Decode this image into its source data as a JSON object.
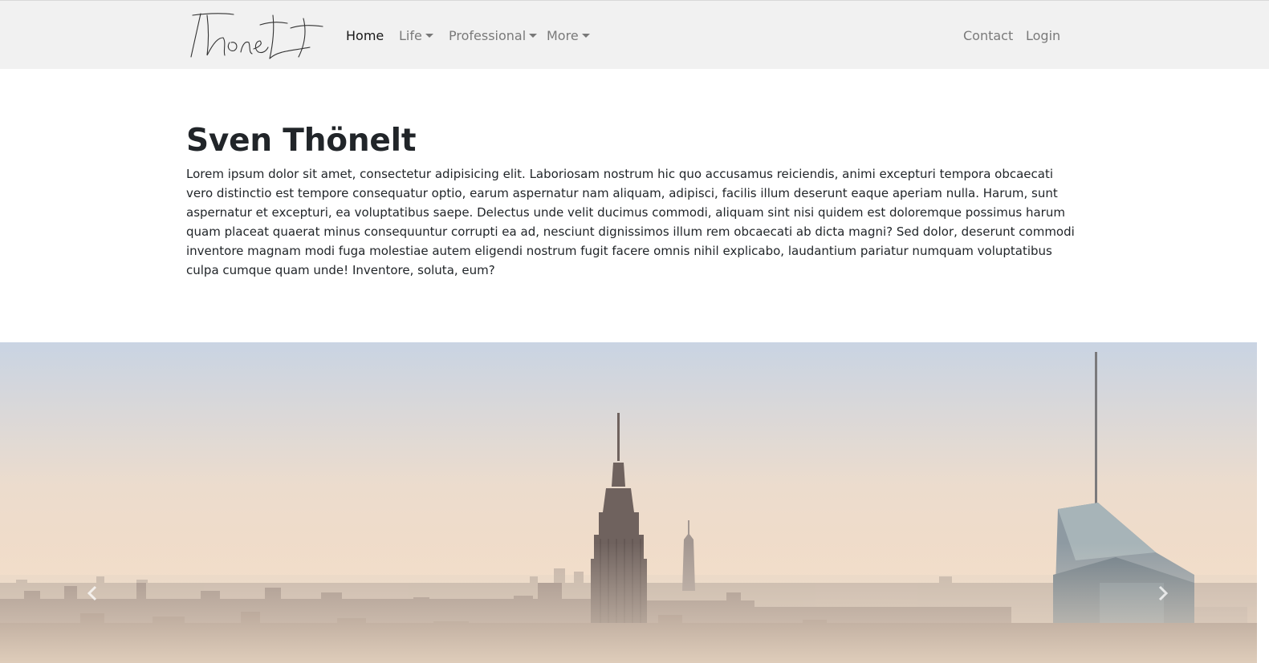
{
  "navbar": {
    "brand_logo": "Thönelt",
    "items": [
      {
        "label": "Home"
      },
      {
        "label": "Life"
      },
      {
        "label": "Professional"
      },
      {
        "label": "More"
      }
    ],
    "right_items": [
      {
        "label": "Contact"
      },
      {
        "label": "Login"
      }
    ]
  },
  "main": {
    "title": "Sven Thönelt",
    "intro": "Lorem ipsum dolor sit amet, consectetur adipisicing elit. Laboriosam nostrum hic quo accusamus reiciendis, animi excepturi tempora obcaecati vero distinctio est tempore consequatur optio, earum aspernatur nam aliquam, adipisci, facilis illum deserunt eaque aperiam nulla. Harum, sunt aspernatur et excepturi, ea voluptatibus saepe. Delectus unde velit ducimus commodi, aliquam sint nisi quidem est doloremque possimus harum quam placeat quaerat minus consequuntur corrupti ea ad, nesciunt dignissimos illum rem obcaecati ab dicta magni? Sed dolor, deserunt commodi inventore magnam modi fuga molestiae autem eligendi nostrum fugit facere omnis nihil explicabo, laudantium pariatur numquam voluptatibus culpa cumque quam unde! Inventore, soluta, eum?"
  },
  "carousel": {
    "slide_image": "city-skyline-photo",
    "prev_icon": "chevron-left-icon",
    "next_icon": "chevron-right-icon"
  },
  "colors": {
    "navbar_bg": "#f1f1f1",
    "text": "#212529",
    "nav_text": "#808080",
    "nav_active": "#1a1a1a"
  }
}
